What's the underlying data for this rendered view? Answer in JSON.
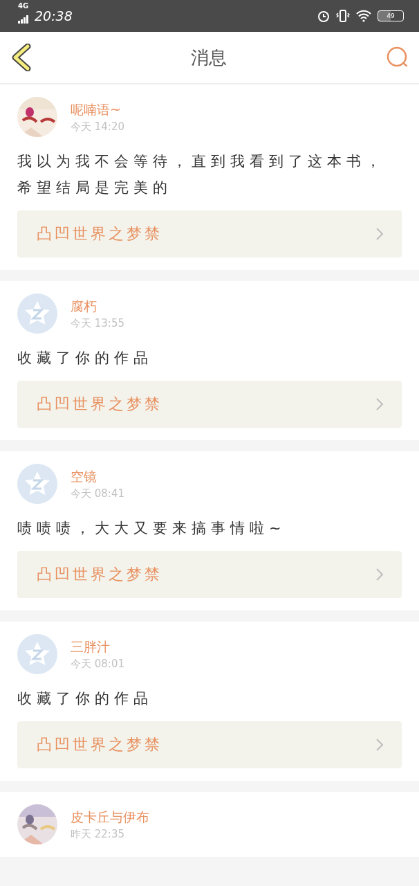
{
  "status_bar": {
    "network": "4G",
    "time": "20:38",
    "battery": "49"
  },
  "header": {
    "title": "消息"
  },
  "messages": [
    {
      "name": "呢喃语~",
      "time": "今天 14:20",
      "text": "我以为我不会等待，直到我看到了这本书，希望结局是完美的",
      "book": "凸凹世界之梦禁"
    },
    {
      "avatar": {
        "kind": "default"
      },
      "name": "腐朽",
      "time": "今天 13:55",
      "text": "收藏了你的作品",
      "book": "凸凹世界之梦禁"
    },
    {
      "avatar": {
        "kind": "default"
      },
      "name": "空镜",
      "time": "今天 08:41",
      "text": "啧啧啧，大大又要来搞事情啦~",
      "book": "凸凹世界之梦禁"
    },
    {
      "avatar": {
        "kind": "default"
      },
      "name": "三胖汁",
      "time": "今天 08:01",
      "text": "收藏了你的作品",
      "book": "凸凹世界之梦禁"
    },
    {
      "name": "皮卡丘与伊布",
      "time": "昨天 22:35"
    }
  ]
}
